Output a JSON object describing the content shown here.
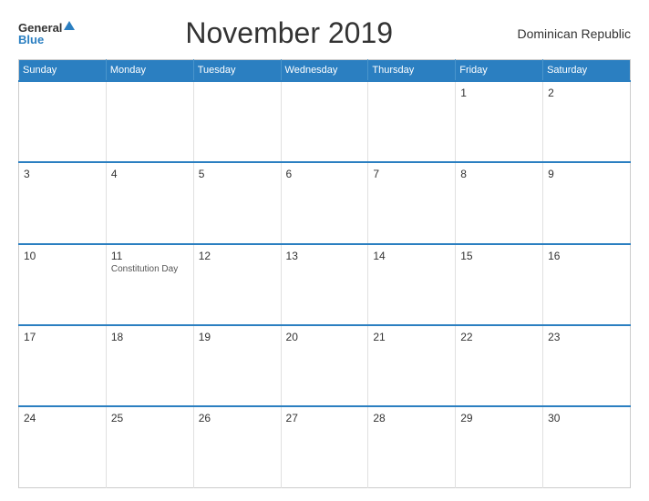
{
  "logo": {
    "general": "General",
    "blue": "Blue"
  },
  "header": {
    "title": "November 2019",
    "country": "Dominican Republic"
  },
  "weekdays": [
    "Sunday",
    "Monday",
    "Tuesday",
    "Wednesday",
    "Thursday",
    "Friday",
    "Saturday"
  ],
  "weeks": [
    [
      {
        "day": "",
        "empty": true
      },
      {
        "day": "",
        "empty": true
      },
      {
        "day": "",
        "empty": true
      },
      {
        "day": "",
        "empty": true
      },
      {
        "day": "",
        "empty": true
      },
      {
        "day": "1",
        "holiday": ""
      },
      {
        "day": "2",
        "holiday": ""
      }
    ],
    [
      {
        "day": "3",
        "holiday": ""
      },
      {
        "day": "4",
        "holiday": ""
      },
      {
        "day": "5",
        "holiday": ""
      },
      {
        "day": "6",
        "holiday": ""
      },
      {
        "day": "7",
        "holiday": ""
      },
      {
        "day": "8",
        "holiday": ""
      },
      {
        "day": "9",
        "holiday": ""
      }
    ],
    [
      {
        "day": "10",
        "holiday": ""
      },
      {
        "day": "11",
        "holiday": "Constitution Day"
      },
      {
        "day": "12",
        "holiday": ""
      },
      {
        "day": "13",
        "holiday": ""
      },
      {
        "day": "14",
        "holiday": ""
      },
      {
        "day": "15",
        "holiday": ""
      },
      {
        "day": "16",
        "holiday": ""
      }
    ],
    [
      {
        "day": "17",
        "holiday": ""
      },
      {
        "day": "18",
        "holiday": ""
      },
      {
        "day": "19",
        "holiday": ""
      },
      {
        "day": "20",
        "holiday": ""
      },
      {
        "day": "21",
        "holiday": ""
      },
      {
        "day": "22",
        "holiday": ""
      },
      {
        "day": "23",
        "holiday": ""
      }
    ],
    [
      {
        "day": "24",
        "holiday": ""
      },
      {
        "day": "25",
        "holiday": ""
      },
      {
        "day": "26",
        "holiday": ""
      },
      {
        "day": "27",
        "holiday": ""
      },
      {
        "day": "28",
        "holiday": ""
      },
      {
        "day": "29",
        "holiday": ""
      },
      {
        "day": "30",
        "holiday": ""
      }
    ]
  ]
}
